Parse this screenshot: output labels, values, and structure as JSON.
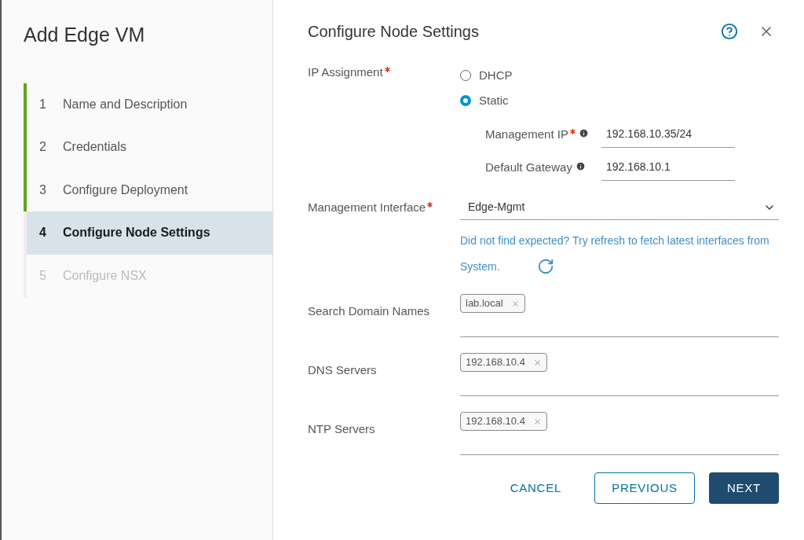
{
  "wizard": {
    "title": "Add Edge VM",
    "steps": [
      {
        "number": "1",
        "label": "Name and Description",
        "completed": true,
        "selected": false,
        "disabled": false
      },
      {
        "number": "2",
        "label": "Credentials",
        "completed": true,
        "selected": false,
        "disabled": false
      },
      {
        "number": "3",
        "label": "Configure Deployment",
        "completed": true,
        "selected": false,
        "disabled": false
      },
      {
        "number": "4",
        "label": "Configure Node Settings",
        "completed": false,
        "selected": true,
        "disabled": false
      },
      {
        "number": "5",
        "label": "Configure NSX",
        "completed": false,
        "selected": false,
        "disabled": true
      }
    ]
  },
  "page": {
    "title": "Configure Node Settings",
    "ip_assignment": {
      "label": "IP Assignment",
      "required": true,
      "options": [
        {
          "label": "DHCP",
          "selected": false
        },
        {
          "label": "Static",
          "selected": true
        }
      ],
      "fields": [
        {
          "label": "Management IP",
          "required": true,
          "value": "192.168.10.35/24"
        },
        {
          "label": "Default Gateway",
          "required": false,
          "value": "192.168.10.1"
        }
      ]
    },
    "management_interface": {
      "label": "Management Interface",
      "required": true,
      "value": "Edge-Mgmt",
      "hint": "Did not find expected? Try refresh to fetch latest interfaces from System."
    },
    "tag_fields": [
      {
        "label": "Search Domain Names",
        "tags": [
          "lab.local"
        ]
      },
      {
        "label": "DNS Servers",
        "tags": [
          "192.168.10.4"
        ]
      },
      {
        "label": "NTP Servers",
        "tags": [
          "192.168.10.4"
        ]
      }
    ],
    "buttons": [
      {
        "kind": "link",
        "label": "CANCEL"
      },
      {
        "kind": "outline",
        "label": "PREVIOUS"
      },
      {
        "kind": "primary",
        "label": "NEXT"
      }
    ]
  }
}
